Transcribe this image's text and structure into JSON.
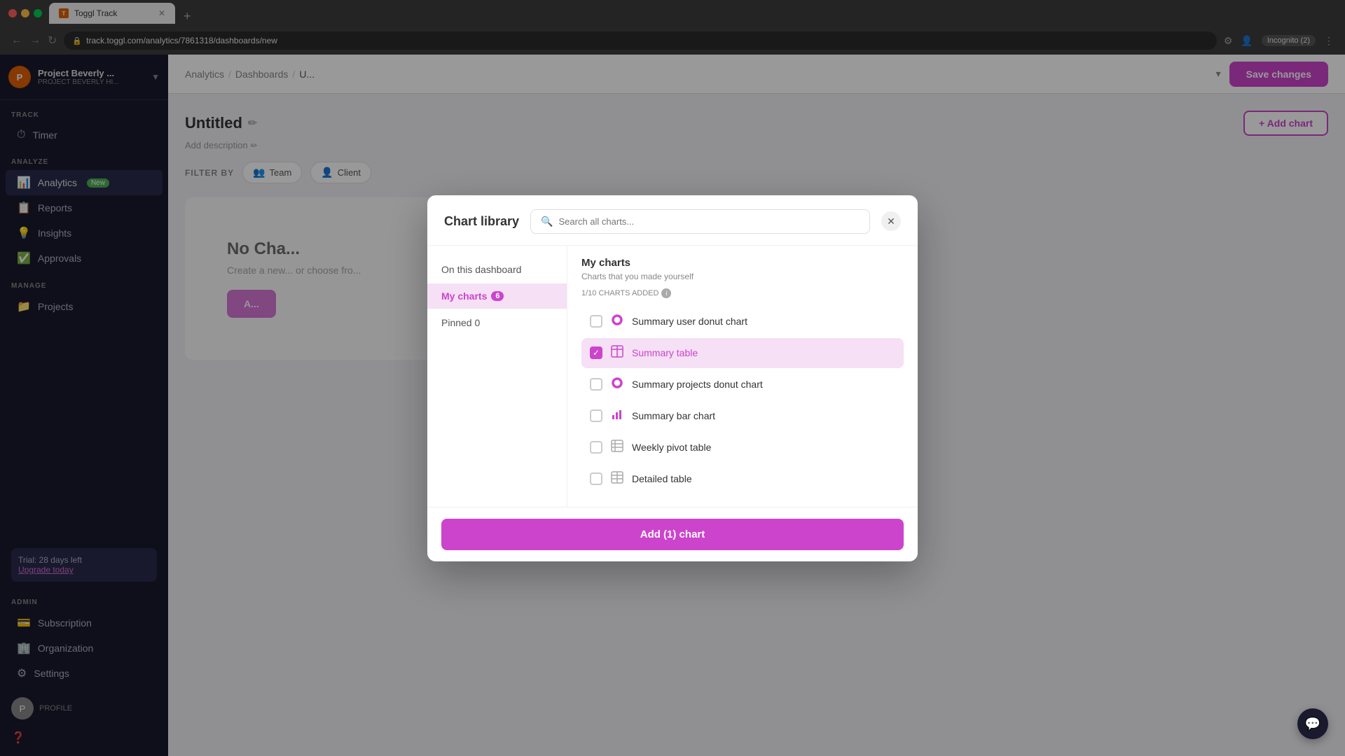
{
  "browser": {
    "url": "track.toggl.com/analytics/7861318/dashboards/new",
    "tab_title": "Toggl Track",
    "incognito_label": "Incognito (2)"
  },
  "sidebar": {
    "brand_name": "Project Beverly ...",
    "brand_sub": "PROJECT BEVERLY HI...",
    "brand_initial": "P",
    "track_label": "TRACK",
    "timer_label": "Timer",
    "analyze_label": "ANALYZE",
    "analytics_label": "Analytics",
    "analytics_badge": "New",
    "reports_label": "Reports",
    "insights_label": "Insights",
    "approvals_label": "Approvals",
    "manage_label": "MANAGE",
    "projects_label": "Projects",
    "trial_text": "Trial: 28 days left",
    "upgrade_text": "Upgrade today",
    "admin_label": "ADMIN",
    "subscription_label": "Subscription",
    "organization_label": "Organization",
    "settings_label": "Settings"
  },
  "topbar": {
    "analytics_link": "Analytics",
    "dashboards_link": "Dashboards",
    "current_page": "U...",
    "save_label": "Save changes",
    "add_chart_label": "+ Add chart"
  },
  "dashboard": {
    "title": "Untitled",
    "add_desc": "Add description",
    "filter_by": "FILTER BY",
    "team_label": "Team",
    "client_label": "Client",
    "no_charts_title": "No Cha...",
    "no_charts_sub": "Create a new...\nor choose fro...",
    "create_btn_label": "A..."
  },
  "modal": {
    "title": "Chart library",
    "search_placeholder": "Search all charts...",
    "nav_items": [
      {
        "id": "on-this-dashboard",
        "label": "On this dashboard"
      },
      {
        "id": "my-charts",
        "label": "My charts",
        "badge": "6",
        "active": true
      },
      {
        "id": "pinned",
        "label": "Pinned 0"
      }
    ],
    "charts_section": {
      "title": "My charts",
      "subtitle": "Charts that you made yourself",
      "added_label": "1/10 CHARTS ADDED"
    },
    "charts": [
      {
        "id": "summary-user-donut",
        "name": "Summary user donut chart",
        "icon": "donut",
        "checked": false
      },
      {
        "id": "summary-table",
        "name": "Summary table",
        "icon": "table",
        "checked": true
      },
      {
        "id": "summary-projects-donut",
        "name": "Summary projects donut chart",
        "icon": "donut",
        "checked": false
      },
      {
        "id": "summary-bar-chart",
        "name": "Summary bar chart",
        "icon": "bar",
        "checked": false
      },
      {
        "id": "weekly-pivot-table",
        "name": "Weekly pivot table",
        "icon": "pivot",
        "checked": false
      },
      {
        "id": "detailed-table",
        "name": "Detailed table",
        "icon": "table2",
        "checked": false
      }
    ],
    "add_btn_label": "Add (1) chart"
  }
}
